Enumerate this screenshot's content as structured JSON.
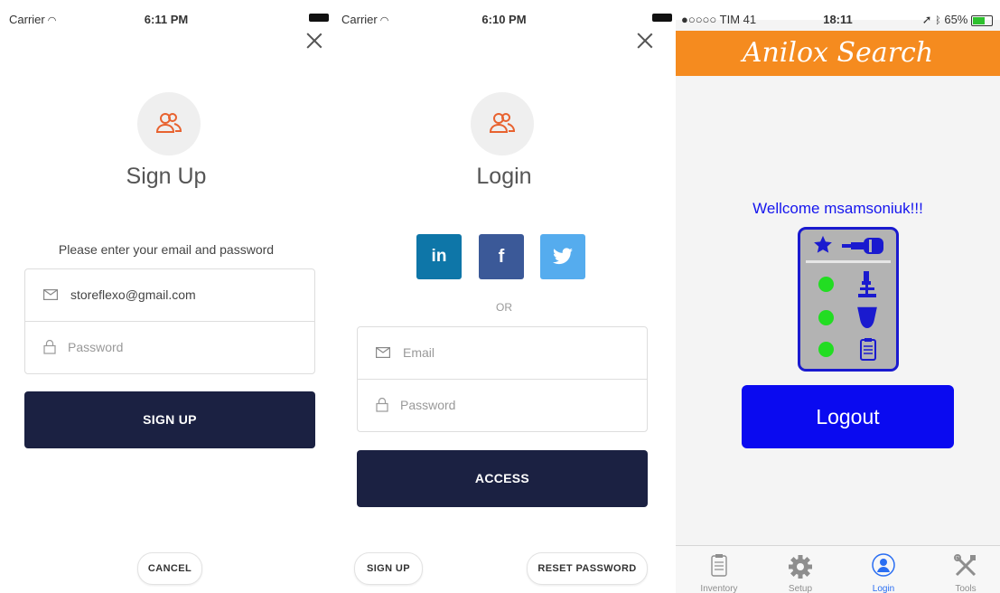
{
  "signup_screen": {
    "status": {
      "carrier": "Carrier",
      "time": "6:11 PM"
    },
    "title": "Sign Up",
    "prompt": "Please enter your email and password",
    "email_value": "storeflexo@gmail.com",
    "password_placeholder": "Password",
    "submit_label": "SIGN UP",
    "cancel_label": "CANCEL"
  },
  "login_screen": {
    "status": {
      "carrier": "Carrier",
      "time": "6:10 PM"
    },
    "title": "Login",
    "social": {
      "linkedin": "in",
      "facebook": "f"
    },
    "or_label": "OR",
    "email_placeholder": "Email",
    "password_placeholder": "Password",
    "submit_label": "ACCESS",
    "signup_label": "SIGN UP",
    "reset_label": "RESET PASSWORD"
  },
  "anilox_screen": {
    "status": {
      "carrier": "●○○○○ TIM 41",
      "time": "18:11",
      "battery": "65%"
    },
    "banner_title": "Anilox Search",
    "welcome": "Wellcome msamsoniuk!!!",
    "logout_label": "Logout",
    "tabs": [
      {
        "label": "Inventory",
        "icon": "clipboard-icon",
        "active": false
      },
      {
        "label": "Setup",
        "icon": "gear-icon",
        "active": false
      },
      {
        "label": "Login",
        "icon": "user-icon",
        "active": true
      },
      {
        "label": "Tools",
        "icon": "tools-icon",
        "active": false
      }
    ]
  },
  "colors": {
    "primary_navy": "#1b2142",
    "accent_orange": "#f58b1f",
    "logout_blue": "#0a0af0",
    "linkedin": "#0e76a8",
    "facebook": "#3b5998",
    "twitter": "#55acee"
  }
}
